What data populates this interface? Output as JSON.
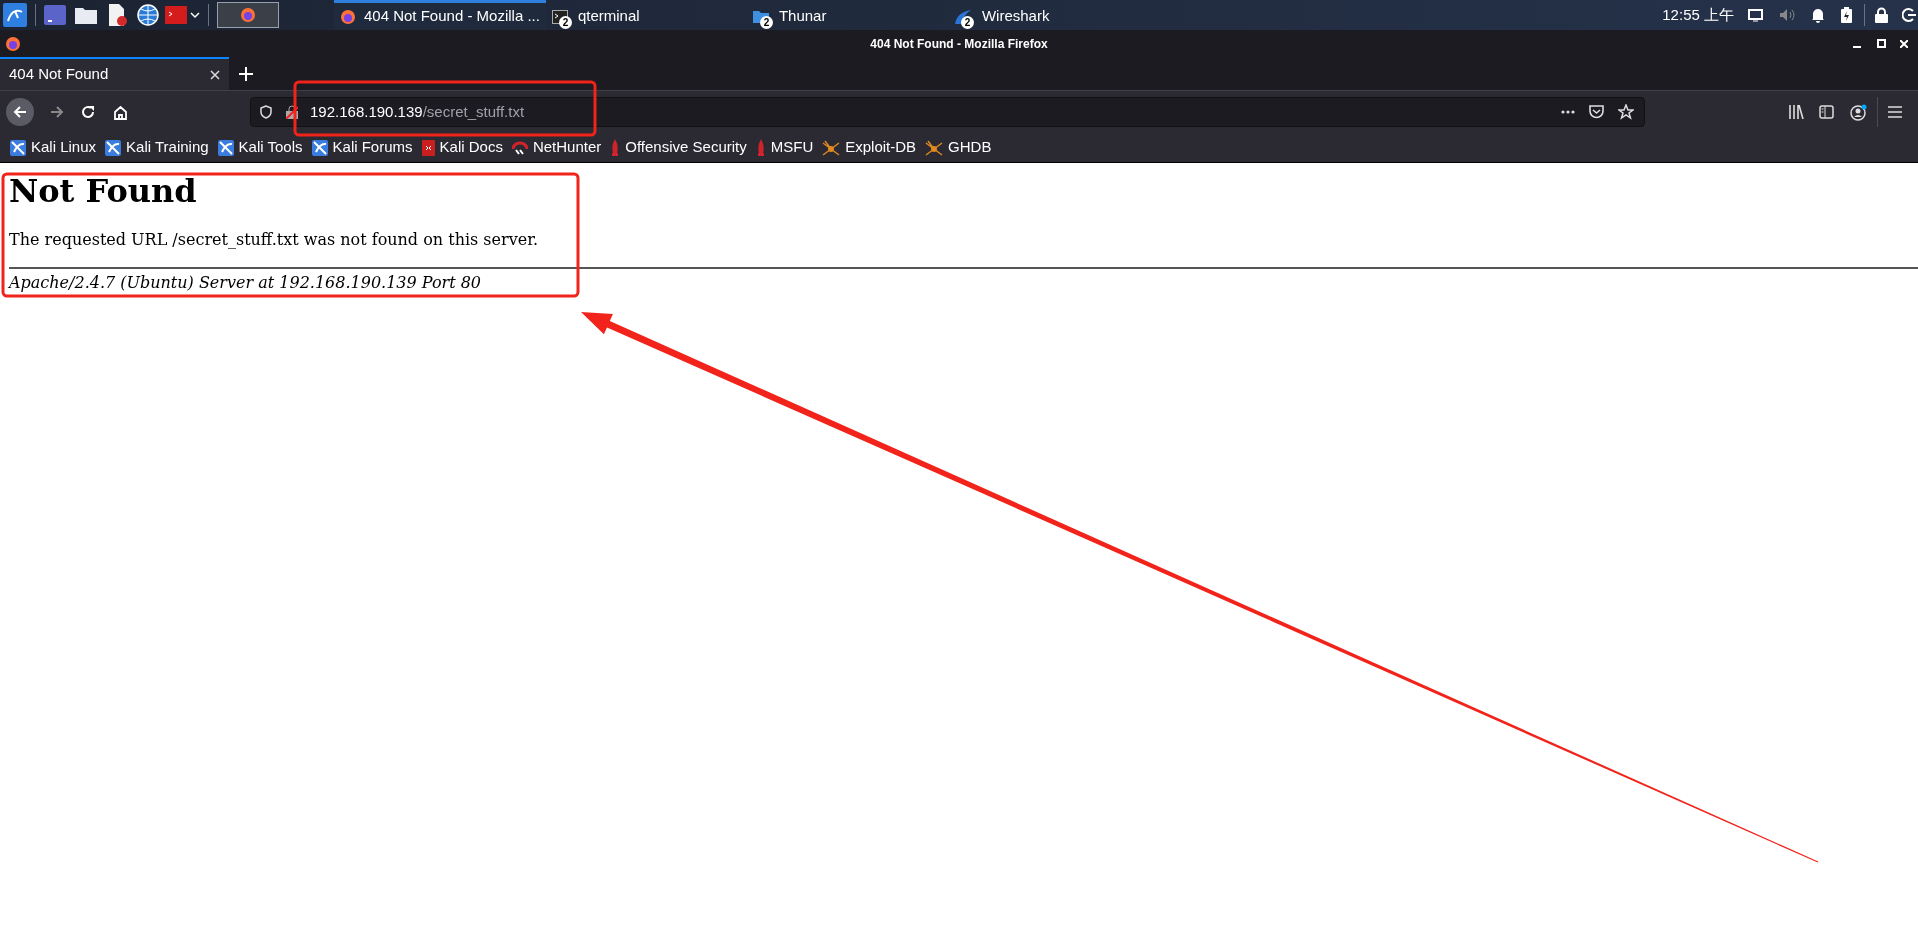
{
  "taskbar": {
    "tasks": [
      {
        "kind": "firefox",
        "label": "404 Not Found - Mozilla ...",
        "selected": true
      },
      {
        "kind": "terminal",
        "label": "qterminal",
        "selected": false,
        "badge": "2"
      },
      {
        "kind": "folder",
        "label": "Thunar",
        "selected": false,
        "badge": "2"
      },
      {
        "kind": "wireshark",
        "label": "Wireshark",
        "selected": false,
        "badge": "2"
      }
    ],
    "clock": "12:55 上午"
  },
  "window": {
    "title": "404 Not Found - Mozilla Firefox"
  },
  "tabs": [
    {
      "label": "404 Not Found",
      "selected": true
    }
  ],
  "address_bar": {
    "host": "192.168.190.139",
    "path": "/secret_stuff.txt"
  },
  "bookmarks": [
    {
      "kind": "kali",
      "label": "Kali Linux"
    },
    {
      "kind": "kali",
      "label": "Kali Training"
    },
    {
      "kind": "kali",
      "label": "Kali Tools"
    },
    {
      "kind": "kali",
      "label": "Kali Forums"
    },
    {
      "kind": "docs",
      "label": "Kali Docs"
    },
    {
      "kind": "nethunter",
      "label": "NetHunter"
    },
    {
      "kind": "offsec",
      "label": "Offensive Security"
    },
    {
      "kind": "offsec",
      "label": "MSFU"
    },
    {
      "kind": "spider",
      "label": "Exploit-DB"
    },
    {
      "kind": "spider",
      "label": "GHDB"
    }
  ],
  "page": {
    "heading": "Not Found",
    "message": "The requested URL /secret_stuff.txt was not found on this server.",
    "signature": "Apache/2.4.7 (Ubuntu) Server at 192.168.190.139 Port 80"
  }
}
